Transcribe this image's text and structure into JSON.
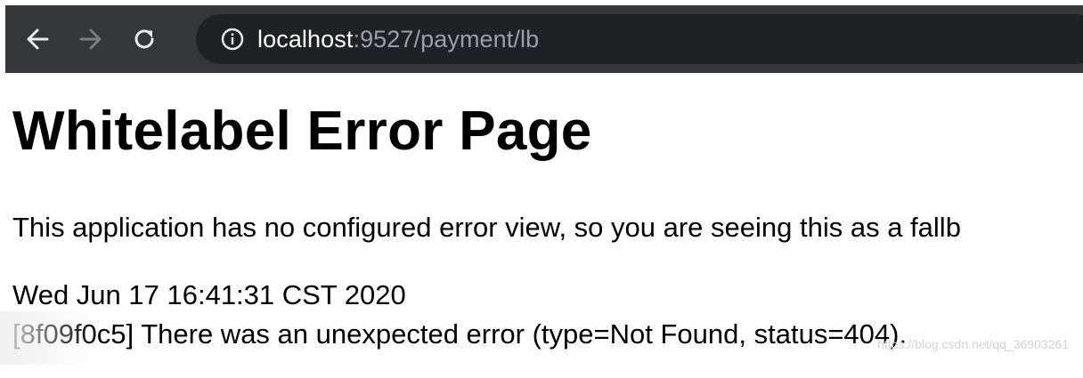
{
  "browser": {
    "url_host": "localhost",
    "url_rest": ":9527/payment/lb",
    "icons": {
      "back": "back-arrow-icon",
      "forward": "forward-arrow-icon",
      "reload": "reload-icon",
      "site_info": "info-icon"
    },
    "colors": {
      "toolbar": "#35363a",
      "omnibox": "#202124",
      "url_host": "#ffffff",
      "url_rest": "#9aa0a6"
    }
  },
  "page": {
    "title": "Whitelabel Error Page",
    "description": "This application has no configured error view, so you are seeing this as a fallb",
    "timestamp": "Wed Jun 17 16:41:31 CST 2020",
    "error_message": "[8f09f0c5] There was an unexpected error (type=Not Found, status=404).",
    "watermark": "https://blog.csdn.net/qq_36903261"
  }
}
